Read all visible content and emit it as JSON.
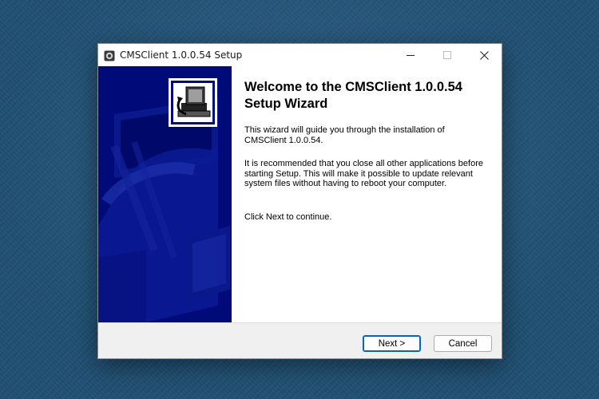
{
  "window": {
    "title": "CMSClient 1.0.0.54 Setup"
  },
  "content": {
    "heading": "Welcome to the CMSClient 1.0.0.54 Setup Wizard",
    "paragraphs": [
      "This wizard will guide you through the installation of CMSClient 1.0.0.54.",
      "It is recommended that you close all other applications before starting Setup. This will make it possible to update relevant system files without having to reboot your computer.",
      "Click Next to continue."
    ]
  },
  "footer": {
    "next_label": "Next >",
    "cancel_label": "Cancel"
  },
  "colors": {
    "sidebar": "#000a78",
    "background": "#1f4f72",
    "default_button_border": "#0067c0"
  },
  "icons": {
    "app": "installer-icon",
    "minimize": "minimize-icon",
    "maximize": "maximize-icon",
    "close": "close-icon",
    "wizard_logo": "computer-install-icon"
  }
}
